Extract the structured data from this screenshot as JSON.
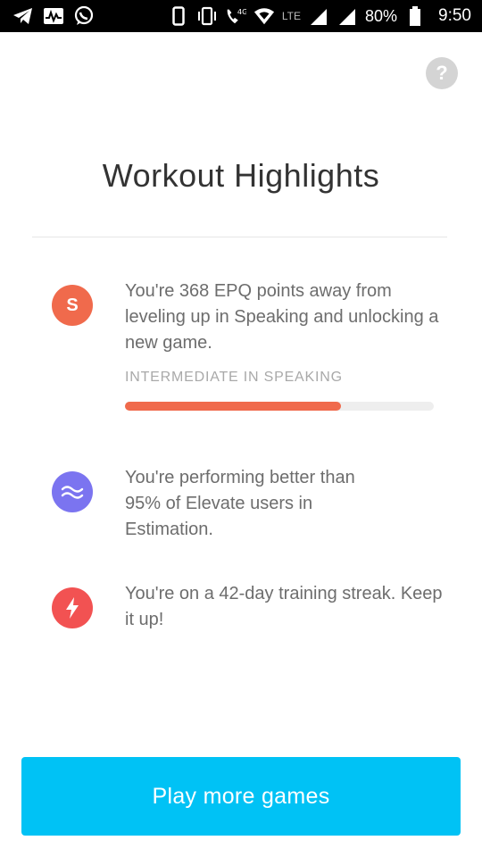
{
  "status_bar": {
    "network_label": "4G",
    "lte_label": "LTE",
    "battery": "80%",
    "time": "9:50"
  },
  "help_label": "?",
  "title": "Workout Highlights",
  "highlights": [
    {
      "badge_text": "S",
      "badge_color": "#f06a4c",
      "text": "You're 368 EPQ points away from leveling up in Speaking and unlocking a new game.",
      "level_label": "INTERMEDIATE IN SPEAKING",
      "progress_fraction": 0.7
    },
    {
      "badge_icon": "wave-icon",
      "badge_color": "#7b74f0",
      "text": "You're performing better than 95% of Elevate users in Estimation."
    },
    {
      "badge_icon": "lightning-icon",
      "badge_color": "#f25252",
      "text": "You're on a 42-day training streak. Keep it up!"
    }
  ],
  "cta": {
    "label": "Play more games",
    "color": "#00c2f5"
  }
}
